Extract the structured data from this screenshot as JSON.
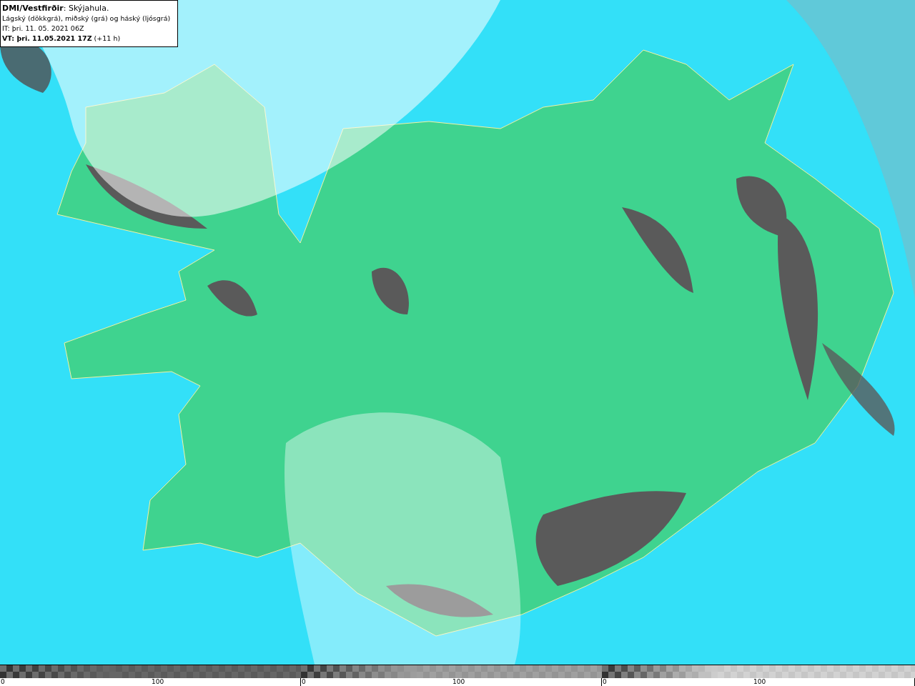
{
  "info_box": {
    "lines": [
      "**DMI/Vestfirðir**: Skýjahula.",
      "Lágský (dökkgrá), miðský (grá) og háský (ljósgrá)",
      "IT: þri. 11. 05. 2021 06Z",
      "**VT: þri. 11.05.2021 17Z** (+11 h)"
    ]
  },
  "legend": {
    "scales": [
      {
        "color": "#666666",
        "min_label": "0",
        "max_label": "100"
      },
      {
        "color": "#a0a0a0",
        "min_label": "0",
        "max_label": "100"
      },
      {
        "color": "#d2d2d2",
        "min_label": "0",
        "max_label": "100"
      }
    ]
  }
}
